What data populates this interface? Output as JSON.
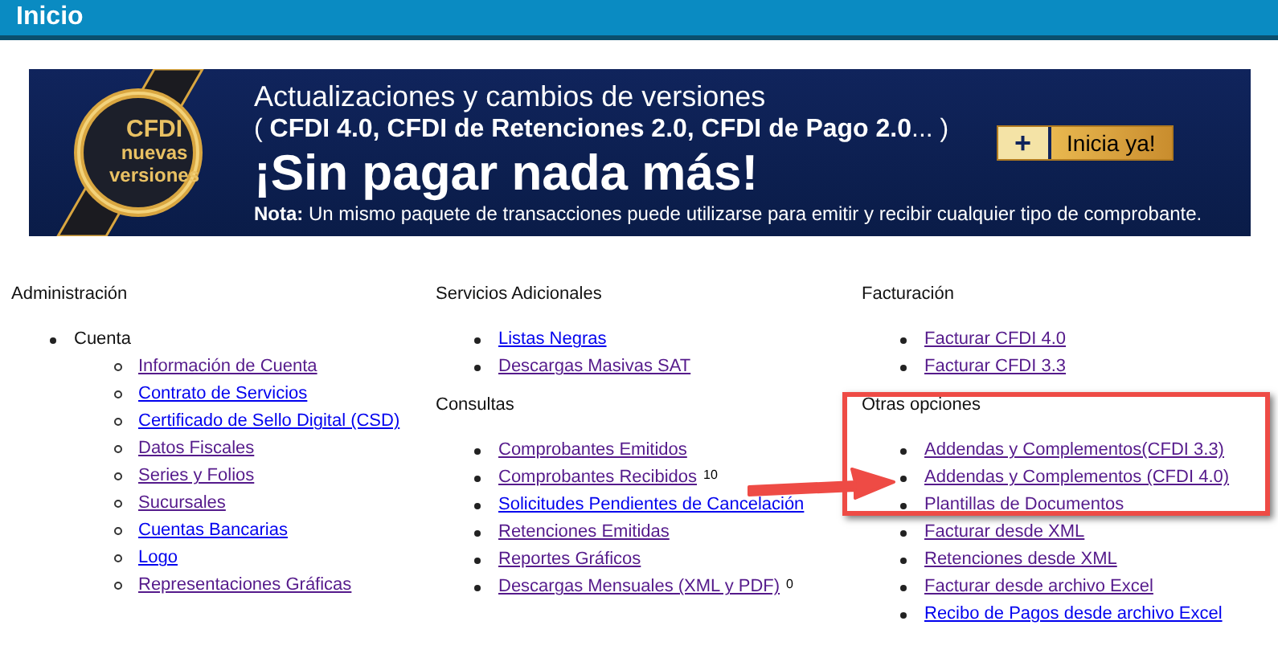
{
  "header": {
    "title": "Inicio"
  },
  "banner": {
    "badge_lines": [
      "CFDI",
      "nuevas",
      "versiones"
    ],
    "line_1": "Actualizaciones y cambios de versiones",
    "line_2": "( **CFDI 4.0, CFDI de Retenciones 2.0, CFDI de Pago 2.0**... )",
    "headline": "¡Sin pagar nada más!",
    "note": "**Nota:** Un mismo paquete de transacciones puede utilizarse para emitir y recibir cualquier tipo de comprobante.",
    "button": {
      "icon": "+",
      "label": "Inicia ya!"
    }
  },
  "columns": [
    {
      "sections": [
        {
          "title": "Administración",
          "groups": [
            {
              "title": "Cuenta",
              "links": [
                {
                  "label": "Información de Cuenta",
                  "visited": true
                },
                {
                  "label": "Contrato de Servicios",
                  "visited": false
                },
                {
                  "label": "Certificado de Sello Digital (CSD)",
                  "visited": false
                },
                {
                  "label": "Datos Fiscales",
                  "visited": true
                },
                {
                  "label": "Series y Folios",
                  "visited": true
                },
                {
                  "label": "Sucursales",
                  "visited": true
                },
                {
                  "label": "Cuentas Bancarias",
                  "visited": false
                },
                {
                  "label": "Logo",
                  "visited": false
                },
                {
                  "label": "Representaciones Gráficas",
                  "visited": true
                }
              ]
            }
          ]
        }
      ]
    },
    {
      "sections": [
        {
          "title": "Servicios Adicionales",
          "links": [
            {
              "label": "Listas Negras",
              "visited": false
            },
            {
              "label": "Descargas Masivas SAT",
              "visited": true
            }
          ]
        },
        {
          "title": "Consultas",
          "links": [
            {
              "label": "Comprobantes Emitidos",
              "visited": true
            },
            {
              "label": "Comprobantes Recibidos",
              "visited": true,
              "count": "10"
            },
            {
              "label": "Solicitudes Pendientes de Cancelación",
              "visited": false
            },
            {
              "label": "Retenciones Emitidas",
              "visited": true
            },
            {
              "label": "Reportes Gráficos",
              "visited": true
            },
            {
              "label": "Descargas Mensuales (XML y PDF)",
              "visited": true,
              "count": "0"
            }
          ]
        }
      ]
    },
    {
      "sections": [
        {
          "title": "Facturación",
          "links": [
            {
              "label": "Facturar CFDI 4.0",
              "visited": true
            },
            {
              "label": "Facturar CFDI 3.3",
              "visited": true
            }
          ]
        },
        {
          "title": "Otras opciones",
          "links": [
            {
              "label": "Addendas y Complementos(CFDI 3.3)",
              "visited": true
            },
            {
              "label": "Addendas y Complementos (CFDI 4.0)",
              "visited": true
            },
            {
              "label": "Plantillas de Documentos",
              "visited": true
            },
            {
              "label": "Facturar desde XML",
              "visited": true
            },
            {
              "label": "Retenciones desde XML",
              "visited": true
            },
            {
              "label": "Facturar desde archivo Excel",
              "visited": true
            },
            {
              "label": "Recibo de Pagos desde archivo Excel",
              "visited": false
            }
          ]
        }
      ]
    }
  ]
}
